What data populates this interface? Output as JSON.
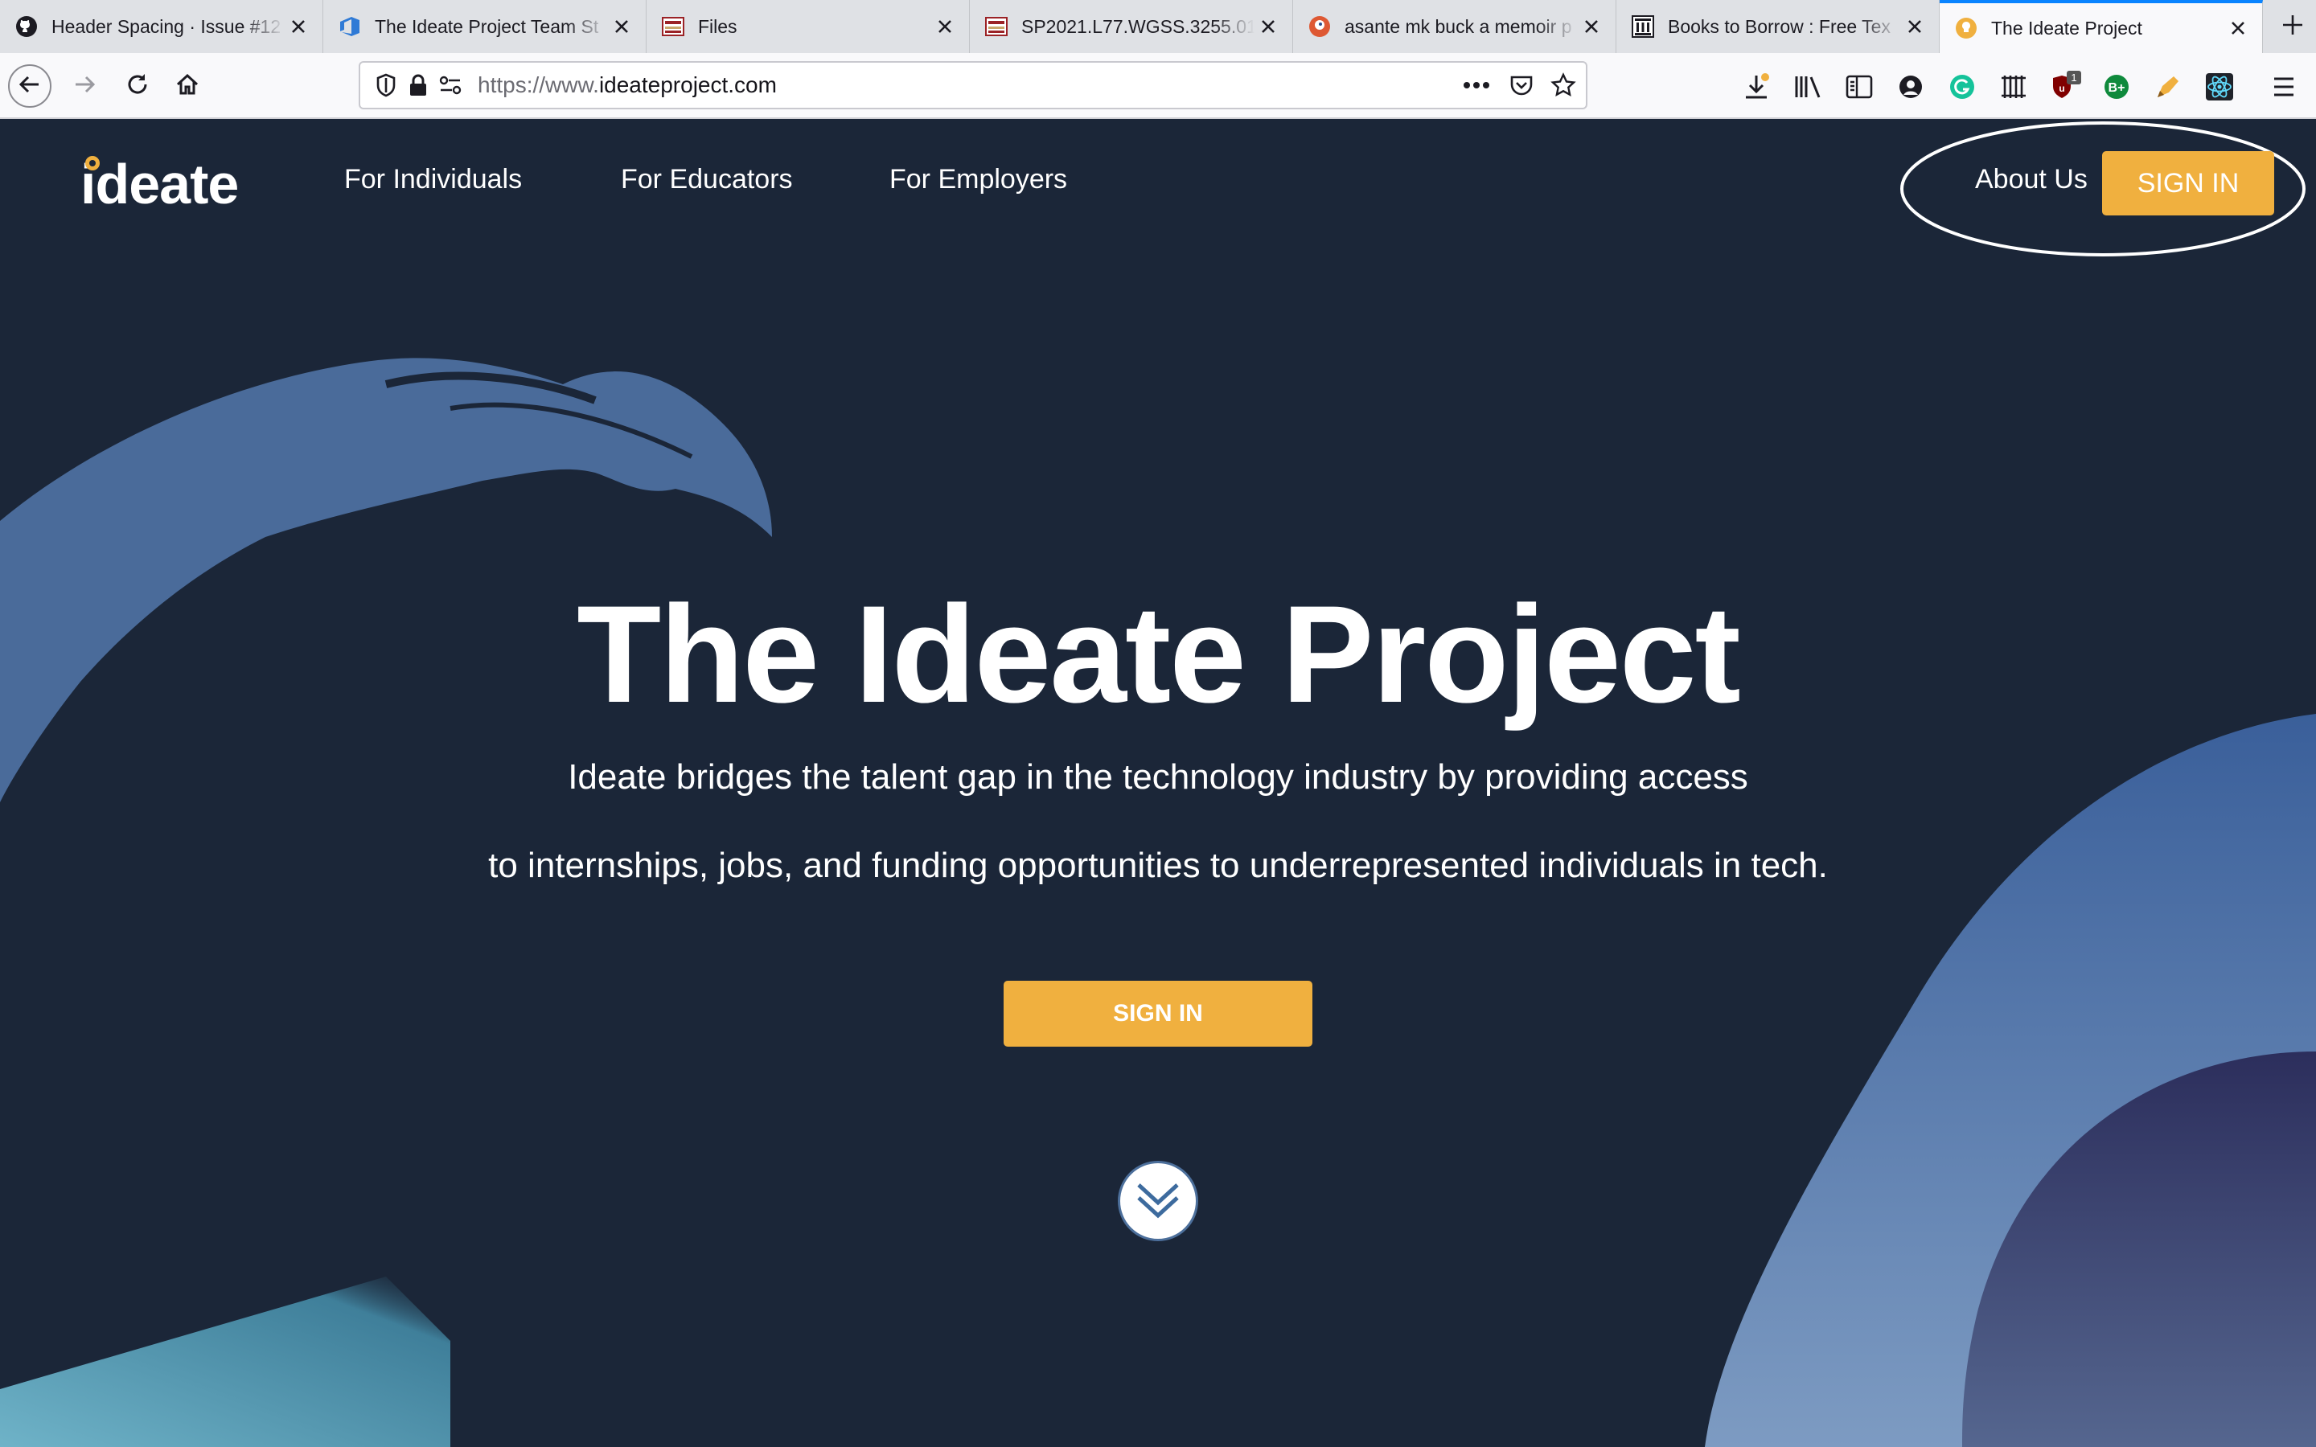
{
  "browser": {
    "tabs": [
      {
        "title": "Header Spacing · Issue #12",
        "icon": "github-icon"
      },
      {
        "title": "The Ideate Project Team St",
        "icon": "azure-devops-icon"
      },
      {
        "title": "Files",
        "icon": "canvas-icon"
      },
      {
        "title": "SP2021.L77.WGSS.3255.01",
        "icon": "canvas-icon"
      },
      {
        "title": "asante mk buck a memoir p",
        "icon": "duckduckgo-icon"
      },
      {
        "title": "Books to Borrow : Free Tex",
        "icon": "archive-icon"
      },
      {
        "title": "The Ideate Project",
        "icon": "ideate-icon",
        "active": true
      }
    ],
    "url_dim": "https://www.",
    "url_main": "ideateproject.com",
    "toolbar_icons": [
      "download-icon",
      "library-icon",
      "sidebar-icon",
      "account-icon",
      "grammarly-icon",
      "extension-icon",
      "ublock-icon",
      "bplus-icon",
      "extension-icon",
      "react-icon",
      "menu-icon"
    ],
    "ublock_badge": "1"
  },
  "site": {
    "logo": "ideate",
    "nav": {
      "individuals": "For Individuals",
      "educators": "For Educators",
      "employers": "For Employers",
      "about": "About Us",
      "signin": "SIGN IN"
    },
    "hero": {
      "title": "The Ideate Project",
      "line1": "Ideate bridges the talent gap in the technology industry by providing access",
      "line2": "to internships, jobs, and funding opportunities to underrepresented individuals in tech.",
      "signin": "SIGN IN"
    },
    "colors": {
      "background": "#1b2638",
      "accent": "#f0b03f"
    }
  }
}
